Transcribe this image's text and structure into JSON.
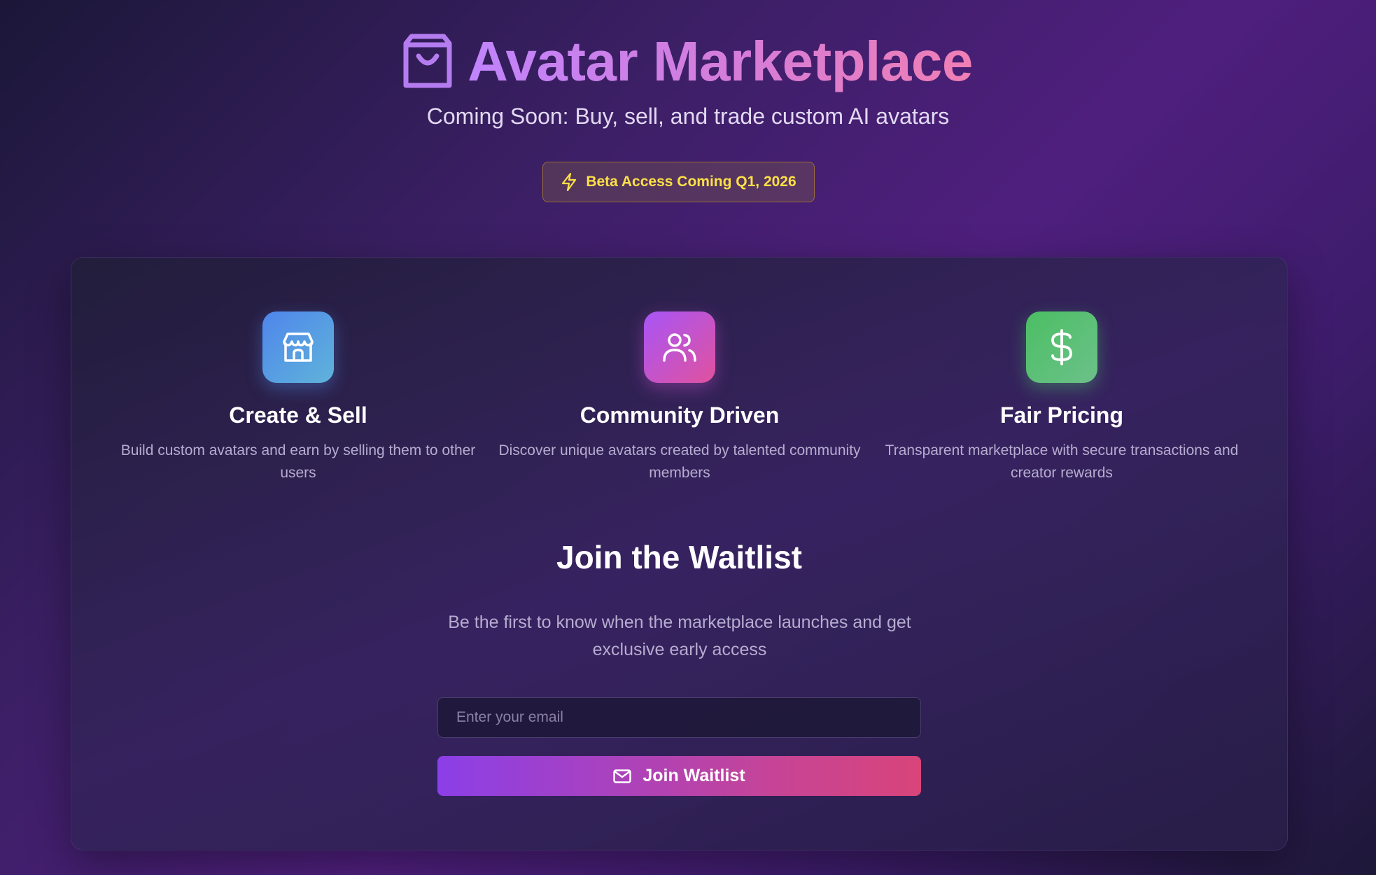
{
  "header": {
    "title": "Avatar Marketplace",
    "subtitle": "Coming Soon: Buy, sell, and trade custom AI avatars",
    "title_icon": "shopping-bag-icon",
    "badge": {
      "label": "Beta Access Coming Q1, 2026",
      "icon": "lightning-icon"
    }
  },
  "features": [
    {
      "icon": "store-icon",
      "title": "Create & Sell",
      "description": "Build custom avatars and earn by selling them to other users"
    },
    {
      "icon": "users-icon",
      "title": "Community Driven",
      "description": "Discover unique avatars created by talented community members"
    },
    {
      "icon": "dollar-icon",
      "title": "Fair Pricing",
      "description": "Transparent marketplace with secure transactions and creator rewards"
    }
  ],
  "waitlist": {
    "title": "Join the Waitlist",
    "description": "Be the first to know when the marketplace launches and get exclusive early access",
    "email_placeholder": "Enter your email",
    "email_value": "",
    "button_label": "Join Waitlist",
    "button_icon": "mail-icon"
  },
  "colors": {
    "title_gradient_start": "#c084fc",
    "title_gradient_end": "#f07fb4",
    "badge_text": "#fde047",
    "button_gradient_start": "#8b3fe8",
    "button_gradient_end": "#d9447a"
  }
}
